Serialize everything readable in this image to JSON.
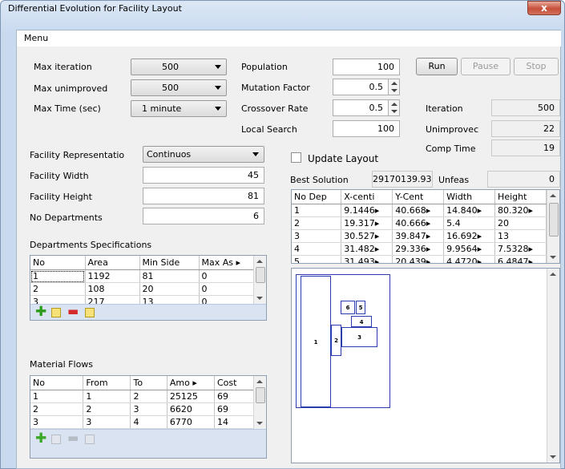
{
  "window": {
    "title": "Differential Evolution for Facility Layout",
    "close_label": "x"
  },
  "menu": {
    "label": "Menu"
  },
  "params": {
    "max_iteration": {
      "label": "Max iteration",
      "value": "500"
    },
    "max_unimproved": {
      "label": "Max unimproved",
      "value": "500"
    },
    "max_time": {
      "label": "Max Time (sec)",
      "value": "1 minute"
    },
    "population": {
      "label": "Population",
      "value": "100"
    },
    "mutation_factor": {
      "label": "Mutation Factor",
      "value": "0.5"
    },
    "crossover_rate": {
      "label": "Crossover Rate",
      "value": "0.5"
    },
    "local_search": {
      "label": "Local Search",
      "value": "100"
    }
  },
  "buttons": {
    "run": "Run",
    "pause": "Pause",
    "stop": "Stop"
  },
  "status": {
    "iteration": {
      "label": "Iteration",
      "value": "500"
    },
    "unimproved": {
      "label": "Unimprovec",
      "value": "22"
    },
    "comp_time": {
      "label": "Comp Time",
      "value": "19"
    }
  },
  "facility": {
    "representation": {
      "label": "Facility Representatio",
      "value": "Continuos"
    },
    "width": {
      "label": "Facility Width",
      "value": "45"
    },
    "height": {
      "label": "Facility Height",
      "value": "81"
    },
    "departments": {
      "label": "No Departments",
      "value": "6"
    }
  },
  "update_layout": {
    "label": "Update Layout",
    "checked": false
  },
  "best": {
    "label": "Best Solution",
    "value": "29170139.93",
    "unfeas_label": "Unfeas",
    "unfeas_value": "0"
  },
  "solution_table": {
    "headers": [
      "No Dep",
      "X-centi",
      "Y-Cent",
      "Width",
      "Height"
    ],
    "rows": [
      [
        "1",
        "9.1446▸",
        "40.668▸",
        "14.840▸",
        "80.320▸"
      ],
      [
        "2",
        "19.317▸",
        "40.666▸",
        "5.4",
        "20"
      ],
      [
        "3",
        "30.527▸",
        "39.847▸",
        "16.692▸",
        "13"
      ],
      [
        "4",
        "31.482▸",
        "29.336▸",
        "9.9564▸",
        "7.5328▸"
      ],
      [
        "5",
        "31.493▸",
        "20.439▸",
        "4.4720▸",
        "6.4847▸"
      ]
    ]
  },
  "dept_specs": {
    "title": "Departments Specifications",
    "headers": [
      "No",
      "Area",
      "Min Side",
      "Max As ▸"
    ],
    "rows": [
      [
        "1",
        "1192",
        "81",
        "0"
      ],
      [
        "2",
        "108",
        "20",
        "0"
      ],
      [
        "3",
        "217",
        "13",
        "0"
      ]
    ]
  },
  "material_flows": {
    "title": "Material Flows",
    "headers": [
      "No",
      "From",
      "To",
      "Amo ▸",
      "Cost"
    ],
    "rows": [
      [
        "1",
        "1",
        "2",
        "25125",
        "69"
      ],
      [
        "2",
        "2",
        "3",
        "6620",
        "69"
      ],
      [
        "3",
        "3",
        "4",
        "6770",
        "14"
      ]
    ]
  },
  "layout_labels": [
    "1",
    "2",
    "3",
    "4",
    "5",
    "6"
  ],
  "icons": {
    "add": "plus-icon",
    "edit": "edit-icon",
    "remove": "minus-icon",
    "save": "save-icon"
  }
}
